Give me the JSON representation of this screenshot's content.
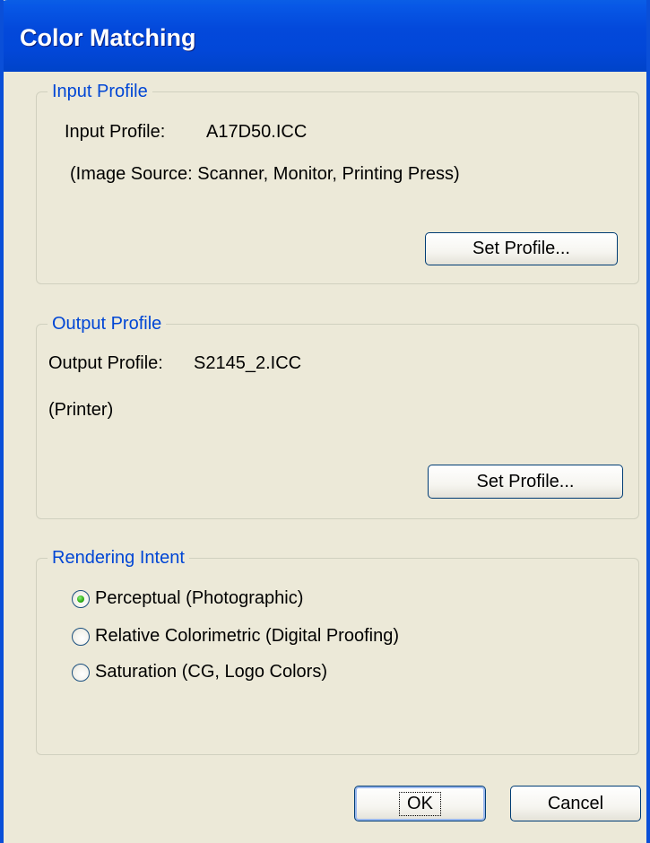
{
  "window": {
    "title": "Color Matching"
  },
  "input_profile": {
    "group_label": "Input Profile",
    "label": "Input Profile:",
    "value": "A17D50.ICC",
    "note": "(Image Source: Scanner, Monitor, Printing Press)",
    "set_button": "Set Profile..."
  },
  "output_profile": {
    "group_label": "Output Profile",
    "label": "Output Profile:",
    "value": "S2145_2.ICC",
    "note": "(Printer)",
    "set_button": "Set Profile..."
  },
  "rendering_intent": {
    "group_label": "Rendering Intent",
    "options": [
      {
        "label": "Perceptual (Photographic)",
        "selected": true
      },
      {
        "label": "Relative Colorimetric (Digital Proofing)",
        "selected": false
      },
      {
        "label": "Saturation (CG, Logo Colors)",
        "selected": false
      }
    ]
  },
  "buttons": {
    "ok": "OK",
    "cancel": "Cancel"
  },
  "colors": {
    "title_bar": "#0349db",
    "dialog_bg": "#ece9d8",
    "group_label": "#0046d5",
    "radio_selected": "#34b21a"
  }
}
